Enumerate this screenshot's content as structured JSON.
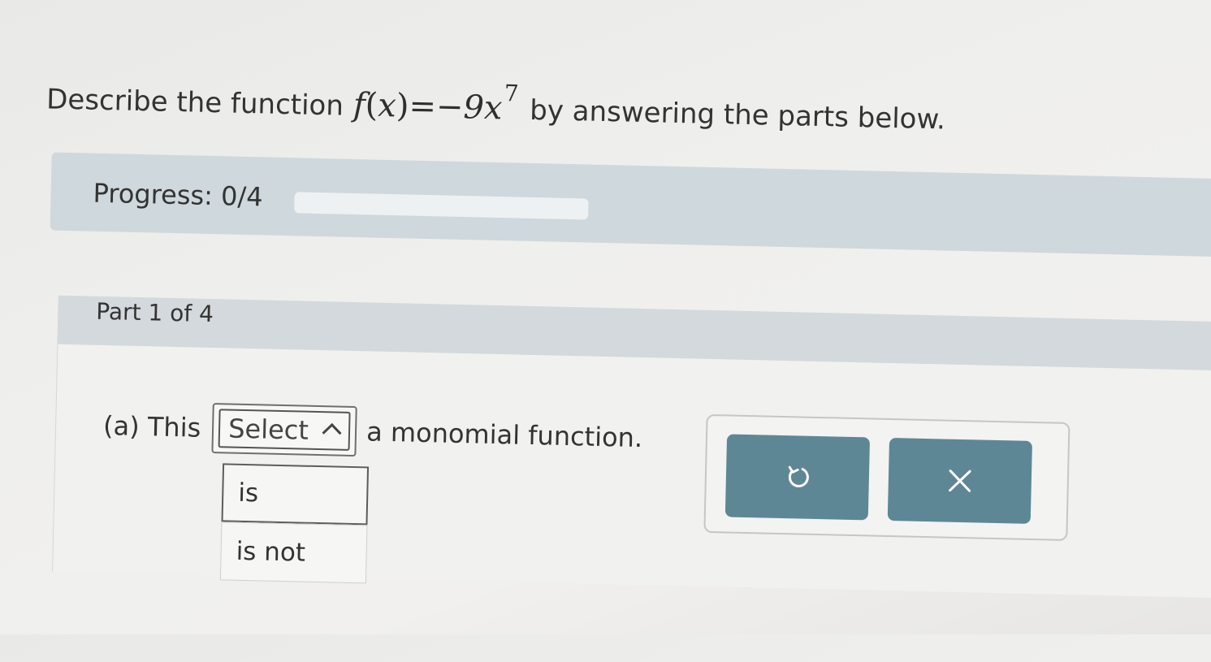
{
  "prompt": {
    "lead": "Describe the function",
    "fx": "f",
    "paren_open": "(",
    "var": "x",
    "paren_close": ")",
    "equals": "=",
    "rhs": "−9x",
    "exponent": "7",
    "tail": "by answering the parts below."
  },
  "progress": {
    "label": "Progress: 0/4",
    "completed": 0,
    "total": 4
  },
  "part": {
    "label": "Part 1 of 4"
  },
  "question": {
    "lead": "(a) This",
    "tail": "a monomial function.",
    "select_value": "Select",
    "options": [
      "is",
      "is not"
    ]
  },
  "actions": {
    "undo_icon": "undo-icon",
    "clear_icon": "close-icon"
  },
  "colors": {
    "accent_button": "#5e8796",
    "band": "#cfd8dc"
  }
}
